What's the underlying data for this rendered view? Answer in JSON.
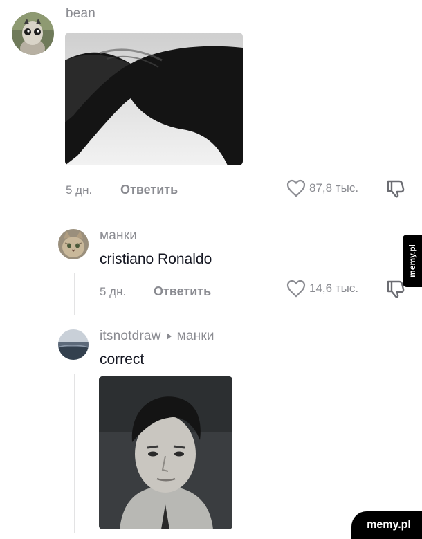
{
  "comments": [
    {
      "username": "bean",
      "time": "5 дн.",
      "reply_label": "Ответить",
      "likes": "87,8 тыс."
    },
    {
      "username": "манки",
      "text": "cristiano Ronaldo",
      "time": "5 дн.",
      "reply_label": "Ответить",
      "likes": "14,6 тыс."
    },
    {
      "username": "itsnotdraw",
      "reply_to": "манки",
      "text": "correct"
    }
  ],
  "watermark": {
    "side": "memy.pl",
    "corner": "memy.pl"
  },
  "icons": {
    "like": "heart-outline-icon",
    "dislike": "thumbs-down-icon",
    "reply_arrow": "reply-triangle-icon"
  },
  "colors": {
    "text": "#161823",
    "muted": "#8a8b91",
    "thread_line": "#e3e3e4"
  }
}
